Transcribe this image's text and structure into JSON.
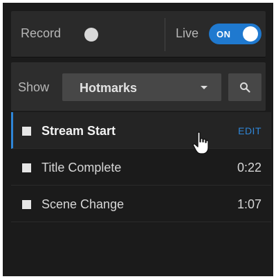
{
  "record": {
    "label": "Record"
  },
  "live": {
    "label": "Live",
    "toggle_text": "ON"
  },
  "filter": {
    "show_label": "Show",
    "selected": "Hotmarks"
  },
  "hotmarks": [
    {
      "label": "Stream Start",
      "action": "EDIT"
    },
    {
      "label": "Title Complete",
      "time": "0:22"
    },
    {
      "label": "Scene Change",
      "time": "1:07"
    }
  ],
  "colors": {
    "accent": "#2f86d8",
    "toggle_on": "#1f79cf",
    "panel_bg": "#1b1b1b"
  },
  "icons": {
    "search": "magnifier-icon",
    "caret": "caret-down-icon",
    "cursor": "hand-pointer-icon"
  }
}
